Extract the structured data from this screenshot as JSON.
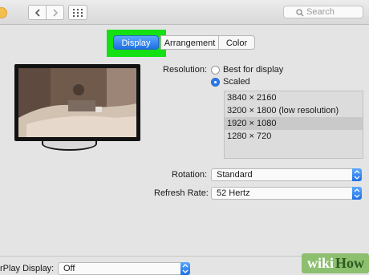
{
  "toolbar": {
    "search_placeholder": "Search",
    "nav_back_icon": "chevron-left-icon",
    "nav_forward_icon": "chevron-right-icon",
    "grid_icon": "grid-icon"
  },
  "tabs": [
    {
      "label": "Display",
      "active": true
    },
    {
      "label": "Arrangement",
      "active": false
    },
    {
      "label": "Color",
      "active": false
    }
  ],
  "resolution": {
    "label": "Resolution:",
    "options": [
      "Best for display",
      "Scaled"
    ],
    "selected_option": "Scaled",
    "list": [
      "3840 × 2160",
      "3200 × 1800 (low resolution)",
      "1920 × 1080",
      "1280 × 720"
    ],
    "selected_item": "1920 × 1080"
  },
  "rotation": {
    "label": "Rotation:",
    "value": "Standard"
  },
  "refresh_rate": {
    "label": "Refresh Rate:",
    "value": "52 Hertz"
  },
  "airplay": {
    "label": "rPlay Display:",
    "value": "Off"
  },
  "watermark": {
    "text_wiki": "wiki",
    "text_how": "How"
  },
  "colors": {
    "highlight": "#14e014",
    "accent": "#2a7bf0"
  }
}
